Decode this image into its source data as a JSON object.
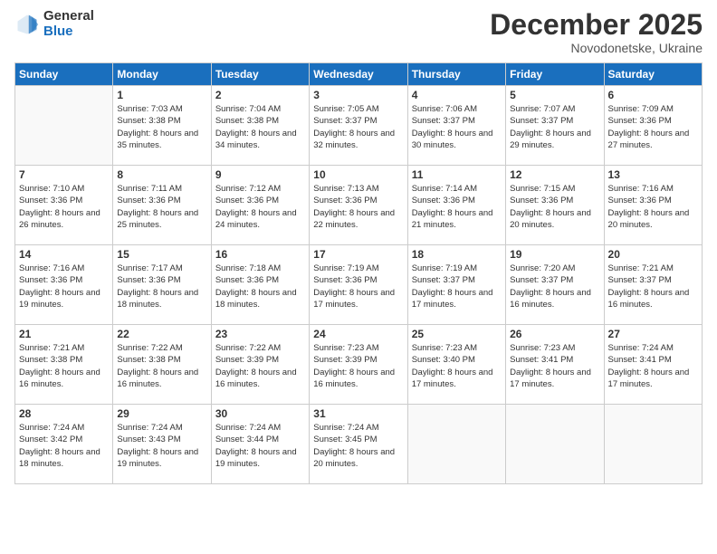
{
  "logo": {
    "general": "General",
    "blue": "Blue"
  },
  "title": "December 2025",
  "subtitle": "Novodonetske, Ukraine",
  "days_of_week": [
    "Sunday",
    "Monday",
    "Tuesday",
    "Wednesday",
    "Thursday",
    "Friday",
    "Saturday"
  ],
  "weeks": [
    [
      {
        "day": "",
        "sunrise": "",
        "sunset": "",
        "daylight": ""
      },
      {
        "day": "1",
        "sunrise": "Sunrise: 7:03 AM",
        "sunset": "Sunset: 3:38 PM",
        "daylight": "Daylight: 8 hours and 35 minutes."
      },
      {
        "day": "2",
        "sunrise": "Sunrise: 7:04 AM",
        "sunset": "Sunset: 3:38 PM",
        "daylight": "Daylight: 8 hours and 34 minutes."
      },
      {
        "day": "3",
        "sunrise": "Sunrise: 7:05 AM",
        "sunset": "Sunset: 3:37 PM",
        "daylight": "Daylight: 8 hours and 32 minutes."
      },
      {
        "day": "4",
        "sunrise": "Sunrise: 7:06 AM",
        "sunset": "Sunset: 3:37 PM",
        "daylight": "Daylight: 8 hours and 30 minutes."
      },
      {
        "day": "5",
        "sunrise": "Sunrise: 7:07 AM",
        "sunset": "Sunset: 3:37 PM",
        "daylight": "Daylight: 8 hours and 29 minutes."
      },
      {
        "day": "6",
        "sunrise": "Sunrise: 7:09 AM",
        "sunset": "Sunset: 3:36 PM",
        "daylight": "Daylight: 8 hours and 27 minutes."
      }
    ],
    [
      {
        "day": "7",
        "sunrise": "Sunrise: 7:10 AM",
        "sunset": "Sunset: 3:36 PM",
        "daylight": "Daylight: 8 hours and 26 minutes."
      },
      {
        "day": "8",
        "sunrise": "Sunrise: 7:11 AM",
        "sunset": "Sunset: 3:36 PM",
        "daylight": "Daylight: 8 hours and 25 minutes."
      },
      {
        "day": "9",
        "sunrise": "Sunrise: 7:12 AM",
        "sunset": "Sunset: 3:36 PM",
        "daylight": "Daylight: 8 hours and 24 minutes."
      },
      {
        "day": "10",
        "sunrise": "Sunrise: 7:13 AM",
        "sunset": "Sunset: 3:36 PM",
        "daylight": "Daylight: 8 hours and 22 minutes."
      },
      {
        "day": "11",
        "sunrise": "Sunrise: 7:14 AM",
        "sunset": "Sunset: 3:36 PM",
        "daylight": "Daylight: 8 hours and 21 minutes."
      },
      {
        "day": "12",
        "sunrise": "Sunrise: 7:15 AM",
        "sunset": "Sunset: 3:36 PM",
        "daylight": "Daylight: 8 hours and 20 minutes."
      },
      {
        "day": "13",
        "sunrise": "Sunrise: 7:16 AM",
        "sunset": "Sunset: 3:36 PM",
        "daylight": "Daylight: 8 hours and 20 minutes."
      }
    ],
    [
      {
        "day": "14",
        "sunrise": "Sunrise: 7:16 AM",
        "sunset": "Sunset: 3:36 PM",
        "daylight": "Daylight: 8 hours and 19 minutes."
      },
      {
        "day": "15",
        "sunrise": "Sunrise: 7:17 AM",
        "sunset": "Sunset: 3:36 PM",
        "daylight": "Daylight: 8 hours and 18 minutes."
      },
      {
        "day": "16",
        "sunrise": "Sunrise: 7:18 AM",
        "sunset": "Sunset: 3:36 PM",
        "daylight": "Daylight: 8 hours and 18 minutes."
      },
      {
        "day": "17",
        "sunrise": "Sunrise: 7:19 AM",
        "sunset": "Sunset: 3:36 PM",
        "daylight": "Daylight: 8 hours and 17 minutes."
      },
      {
        "day": "18",
        "sunrise": "Sunrise: 7:19 AM",
        "sunset": "Sunset: 3:37 PM",
        "daylight": "Daylight: 8 hours and 17 minutes."
      },
      {
        "day": "19",
        "sunrise": "Sunrise: 7:20 AM",
        "sunset": "Sunset: 3:37 PM",
        "daylight": "Daylight: 8 hours and 16 minutes."
      },
      {
        "day": "20",
        "sunrise": "Sunrise: 7:21 AM",
        "sunset": "Sunset: 3:37 PM",
        "daylight": "Daylight: 8 hours and 16 minutes."
      }
    ],
    [
      {
        "day": "21",
        "sunrise": "Sunrise: 7:21 AM",
        "sunset": "Sunset: 3:38 PM",
        "daylight": "Daylight: 8 hours and 16 minutes."
      },
      {
        "day": "22",
        "sunrise": "Sunrise: 7:22 AM",
        "sunset": "Sunset: 3:38 PM",
        "daylight": "Daylight: 8 hours and 16 minutes."
      },
      {
        "day": "23",
        "sunrise": "Sunrise: 7:22 AM",
        "sunset": "Sunset: 3:39 PM",
        "daylight": "Daylight: 8 hours and 16 minutes."
      },
      {
        "day": "24",
        "sunrise": "Sunrise: 7:23 AM",
        "sunset": "Sunset: 3:39 PM",
        "daylight": "Daylight: 8 hours and 16 minutes."
      },
      {
        "day": "25",
        "sunrise": "Sunrise: 7:23 AM",
        "sunset": "Sunset: 3:40 PM",
        "daylight": "Daylight: 8 hours and 17 minutes."
      },
      {
        "day": "26",
        "sunrise": "Sunrise: 7:23 AM",
        "sunset": "Sunset: 3:41 PM",
        "daylight": "Daylight: 8 hours and 17 minutes."
      },
      {
        "day": "27",
        "sunrise": "Sunrise: 7:24 AM",
        "sunset": "Sunset: 3:41 PM",
        "daylight": "Daylight: 8 hours and 17 minutes."
      }
    ],
    [
      {
        "day": "28",
        "sunrise": "Sunrise: 7:24 AM",
        "sunset": "Sunset: 3:42 PM",
        "daylight": "Daylight: 8 hours and 18 minutes."
      },
      {
        "day": "29",
        "sunrise": "Sunrise: 7:24 AM",
        "sunset": "Sunset: 3:43 PM",
        "daylight": "Daylight: 8 hours and 19 minutes."
      },
      {
        "day": "30",
        "sunrise": "Sunrise: 7:24 AM",
        "sunset": "Sunset: 3:44 PM",
        "daylight": "Daylight: 8 hours and 19 minutes."
      },
      {
        "day": "31",
        "sunrise": "Sunrise: 7:24 AM",
        "sunset": "Sunset: 3:45 PM",
        "daylight": "Daylight: 8 hours and 20 minutes."
      },
      {
        "day": "",
        "sunrise": "",
        "sunset": "",
        "daylight": ""
      },
      {
        "day": "",
        "sunrise": "",
        "sunset": "",
        "daylight": ""
      },
      {
        "day": "",
        "sunrise": "",
        "sunset": "",
        "daylight": ""
      }
    ]
  ]
}
